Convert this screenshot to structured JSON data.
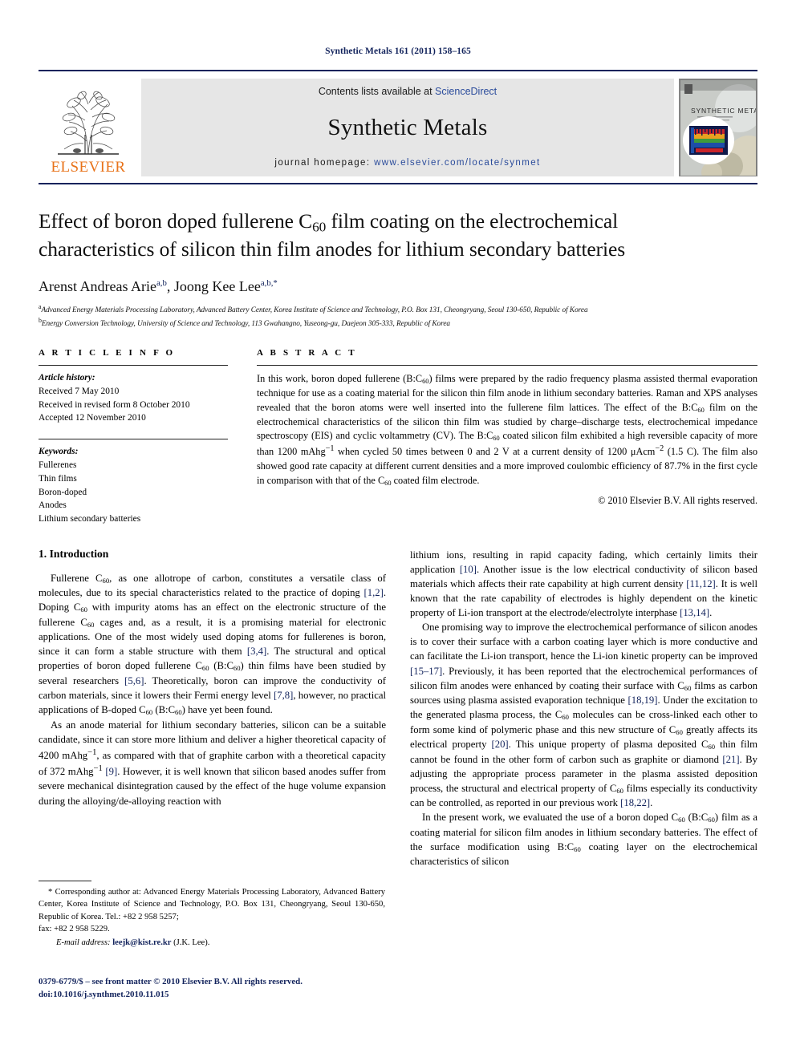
{
  "running_head": "Synthetic Metals 161 (2011) 158–165",
  "masthead": {
    "publisher": "ELSEVIER",
    "contents_prefix": "Contents lists available at ",
    "sciencedirect": "ScienceDirect",
    "journal_title": "Synthetic Metals",
    "homepage_label": "journal homepage: ",
    "homepage_url": "www.elsevier.com/locate/synmet",
    "cover_title": "SYNTHETIC METALS"
  },
  "article": {
    "title_line1_a": "Effect of boron doped fullerene C",
    "title_line1_sub": "60",
    "title_line1_b": " film coating on the electrochemical",
    "title_line2": "characteristics of silicon thin film anodes for lithium secondary batteries",
    "authors_1": "Arenst Andreas Arie",
    "authors_1_sup": "a,b",
    "authors_sep": ", ",
    "authors_2": "Joong Kee Lee",
    "authors_2_sup": "a,b,*",
    "affiliation_a_sup": "a",
    "affiliation_a": "Advanced Energy Materials Processing Laboratory, Advanced Battery Center, Korea Institute of Science and Technology, P.O. Box 131, Cheongryang, Seoul 130-650, Republic of Korea",
    "affiliation_b_sup": "b",
    "affiliation_b": "Energy Conversion Technology, University of Science and Technology, 113 Gwahangno, Yuseong-gu, Daejeon 305-333, Republic of Korea"
  },
  "article_info": {
    "heading": "A R T I C L E    I N F O",
    "history_label": "Article history:",
    "history": [
      "Received 7 May 2010",
      "Received in revised form 8 October 2010",
      "Accepted 12 November 2010"
    ],
    "keywords_label": "Keywords:",
    "keywords": [
      "Fullerenes",
      "Thin films",
      "Boron-doped",
      "Anodes",
      "Lithium secondary batteries"
    ]
  },
  "abstract": {
    "heading": "A B S T R A C T",
    "text": "In this work, boron doped fullerene (B:C60) films were prepared by the radio frequency plasma assisted thermal evaporation technique for use as a coating material for the silicon thin film anode in lithium secondary batteries. Raman and XPS analyses revealed that the boron atoms were well inserted into the fullerene film lattices. The effect of the B:C60 film on the electrochemical characteristics of the silicon thin film was studied by charge–discharge tests, electrochemical impedance spectroscopy (EIS) and cyclic voltammetry (CV). The B:C60 coated silicon film exhibited a high reversible capacity of more than 1200 mAhg−1 when cycled 50 times between 0 and 2 V at a current density of 1200 μAcm−2 (1.5 C). The film also showed good rate capacity at different current densities and a more improved coulombic efficiency of 87.7% in the first cycle in comparison with that of the C60 coated film electrode.",
    "copyright": "© 2010 Elsevier B.V. All rights reserved."
  },
  "introduction": {
    "heading": "1.  Introduction",
    "p1_pre": "Fullerene C",
    "p1": "Fullerene C60, as one allotrope of carbon, constitutes a versatile class of molecules, due to its special characteristics related to the practice of doping [1,2]. Doping C60 with impurity atoms has an effect on the electronic structure of the fullerene C60 cages and, as a result, it is a promising material for electronic applications. One of the most widely used doping atoms for fullerenes is boron, since it can form a stable structure with them [3,4]. The structural and optical properties of boron doped fullerene C60 (B:C60) thin films have been studied by several researchers [5,6]. Theoretically, boron can improve the conductivity of carbon materials, since it lowers their Fermi energy level [7,8], however, no practical applications of B-doped C60 (B:C60) have yet been found.",
    "p2": "As an anode material for lithium secondary batteries, silicon can be a suitable candidate, since it can store more lithium and deliver a higher theoretical capacity of 4200 mAhg−1, as compared with that of graphite carbon with a theoretical capacity of 372 mAhg−1 [9]. However, it is well known that silicon based anodes suffer from severe mechanical disintegration caused by the effect of the huge volume expansion during the alloying/de-alloying reaction with",
    "p3": "lithium ions, resulting in rapid capacity fading, which certainly limits their application [10]. Another issue is the low electrical conductivity of silicon based materials which affects their rate capability at high current density [11,12]. It is well known that the rate capability of electrodes is highly dependent on the kinetic property of Li-ion transport at the electrode/electrolyte interphase [13,14].",
    "p4": "One promising way to improve the electrochemical performance of silicon anodes is to cover their surface with a carbon coating layer which is more conductive and can facilitate the Li-ion transport, hence the Li-ion kinetic property can be improved [15–17]. Previously, it has been reported that the electrochemical performances of silicon film anodes were enhanced by coating their surface with C60 films as carbon sources using plasma assisted evaporation technique [18,19]. Under the excitation to the generated plasma process, the C60 molecules can be cross-linked each other to form some kind of polymeric phase and this new structure of C60 greatly affects its electrical property [20]. This unique property of plasma deposited C60 thin film cannot be found in the other form of carbon such as graphite or diamond [21]. By adjusting the appropriate process parameter in the plasma assisted deposition process, the structural and electrical property of C60 films especially its conductivity can be controlled, as reported in our previous work [18,22].",
    "p5": "In the present work, we evaluated the use of a boron doped C60 (B:C60) film as a coating material for silicon film anodes in lithium secondary batteries. The effect of the surface modification using B:C60 coating layer on the electrochemical characteristics of silicon"
  },
  "footnote": {
    "star": "*",
    "corresponding": " Corresponding author at: Advanced Energy Materials Processing Laboratory, Advanced Battery Center, Korea Institute of Science and Technology, P.O. Box 131, Cheongryang, Seoul 130-650, Republic of Korea. Tel.: +82 2 958 5257;",
    "fax": "fax: +82 2 958 5229.",
    "email_label": "E-mail address:",
    "email": "leejk@kist.re.kr",
    "email_person": " (J.K. Lee)."
  },
  "issn_line": "0379-6779/$ – see front matter © 2010 Elsevier B.V. All rights reserved.",
  "doi_line": "doi:10.1016/j.synthmet.2010.11.015",
  "colors": {
    "navy": "#12235c",
    "link_blue": "#2a4b9b",
    "elsevier_orange": "#e8731a",
    "banner_gray": "#e6e6e6"
  }
}
